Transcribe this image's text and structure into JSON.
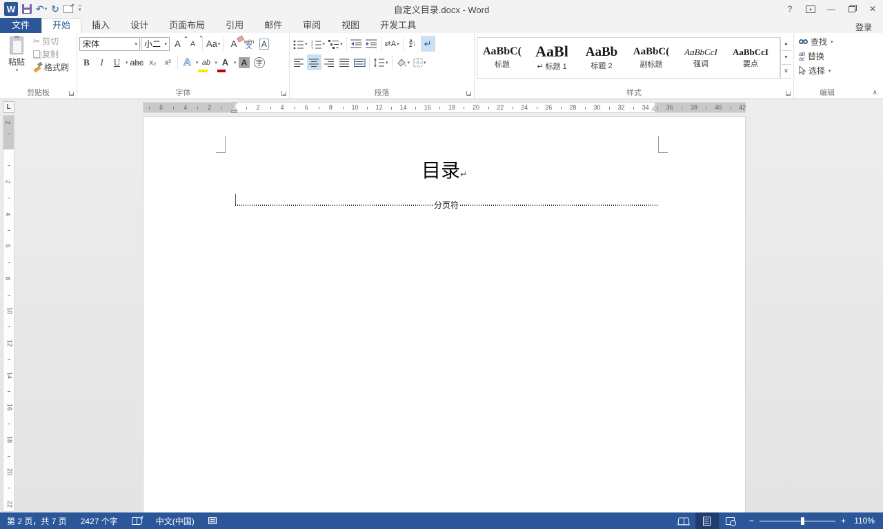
{
  "titlebar": {
    "title": "自定义目录.docx - Word",
    "help": "?",
    "minimize": "—",
    "close": "✕"
  },
  "qat": {
    "undo": "↶",
    "redo": "↻",
    "dropdown": "▾"
  },
  "tabs": {
    "file": "文件",
    "items": [
      "开始",
      "插入",
      "设计",
      "页面布局",
      "引用",
      "邮件",
      "审阅",
      "视图",
      "开发工具"
    ],
    "active": "开始",
    "signin": "登录"
  },
  "ribbon": {
    "clipboard": {
      "label": "剪贴板",
      "paste": "粘贴",
      "cut": "剪切",
      "copy": "复制",
      "format_painter": "格式刷"
    },
    "font": {
      "label": "字体",
      "font_name": "宋体",
      "font_size": "小二",
      "grow": "A",
      "shrink": "A",
      "change_case": "Aa",
      "clear_formatting": "A",
      "phonetic_top": "wén",
      "phonetic_bottom": "文",
      "char_border": "A",
      "bold": "B",
      "italic": "I",
      "underline": "U",
      "strikethrough": "abc",
      "subscript": "x₂",
      "superscript": "x²",
      "text_effects": "A",
      "highlight": "ab",
      "font_color": "A",
      "char_shading": "A",
      "enclose": "字"
    },
    "paragraph": {
      "label": "段落",
      "asian_layout": "⇄A",
      "sort_a": "A",
      "sort_z": "Z",
      "sort_arrow": "↓",
      "show_hide_mark": "↵"
    },
    "styles": {
      "label": "样式",
      "items": [
        {
          "sample": "AaBbC(",
          "label": "标题",
          "size": 16,
          "italic": false,
          "mark": ""
        },
        {
          "sample": "AaBl",
          "label": "标题 1",
          "size": 22,
          "italic": false,
          "mark": "↵"
        },
        {
          "sample": "AaBb",
          "label": "标题 2",
          "size": 19,
          "italic": false,
          "mark": ""
        },
        {
          "sample": "AaBbC(",
          "label": "副标题",
          "size": 15,
          "italic": false,
          "mark": ""
        },
        {
          "sample": "AaBbCcI",
          "label": "强调",
          "size": 13,
          "italic": true,
          "mark": ""
        },
        {
          "sample": "AaBbCcI",
          "label": "要点",
          "size": 13,
          "italic": false,
          "mark": ""
        }
      ]
    },
    "editing": {
      "label": "编辑",
      "find": "查找",
      "replace": "替换",
      "select": "选择",
      "replace_ab": "ab",
      "replace_ac": "ac"
    },
    "collapse": "∧"
  },
  "ruler": {
    "h_left_numbers": [
      6,
      4,
      2
    ],
    "h_main_numbers": [
      2,
      4,
      6,
      8,
      10,
      12,
      14,
      16,
      18,
      20,
      22,
      24,
      26,
      28,
      30,
      32,
      34
    ],
    "h_right_numbers": [
      36,
      38,
      40,
      42
    ],
    "v_top_numbers": [
      2
    ],
    "v_main_numbers": [
      2,
      4,
      6,
      8,
      10,
      12,
      14,
      16,
      18,
      20,
      22
    ],
    "tab_selector": "L"
  },
  "document": {
    "title": "目录",
    "pilcrow": "↵",
    "page_break_label": "分页符"
  },
  "statusbar": {
    "page_info": "第 2 页，共 7 页",
    "word_count": "2427 个字",
    "language": "中文(中国)",
    "zoom_out": "−",
    "zoom_in": "+",
    "zoom_level": "110%"
  },
  "colors": {
    "accent": "#2b579a",
    "active_button": "#cbe0f2",
    "highlight_yellow": "#ffe800",
    "font_color_red": "#c00000"
  }
}
